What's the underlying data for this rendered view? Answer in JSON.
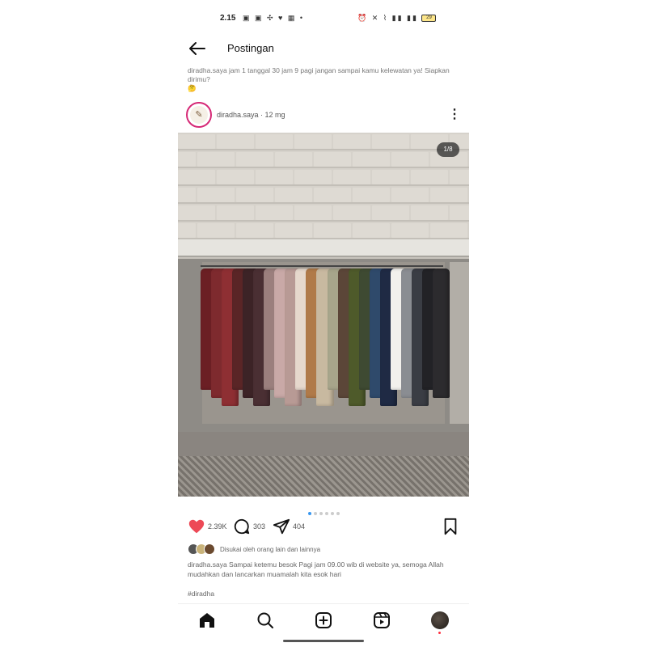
{
  "status_bar": {
    "time": "2.15",
    "left_icons": "▣ ▣ ✣ ♥ ▦ •",
    "right_icons": "⏰ ✕ ⌇ ▮▮ ▮▮",
    "battery": "29"
  },
  "header": {
    "back_icon": "arrow-left-icon",
    "title": "Postingan"
  },
  "caption_top": "diradha.saya jam 1 tanggal 30 jam 9 pagi jangan sampai kamu kelewatan ya! Siapkan dirimu?",
  "caption_top_emoji": "🤔",
  "post": {
    "username": "diradha.saya · 12 mg",
    "avatar_glyph": "✎",
    "image_counter": "1/8",
    "carousel": {
      "count": 6,
      "active": 0
    },
    "likes_count": "2.39K",
    "comments_count": "303",
    "shares_count": "404",
    "liked_by_text": "Disukai oleh orang lain dan lainnya",
    "caption": "diradha.saya Sampai ketemu besok Pagi jam 09.00 wib di website ya, semoga Allah mudahkan dan lancarkan muamalah kita esok hari",
    "hashtags": "#diradha"
  },
  "garment_colors": [
    "#6b1f24",
    "#7e2a2e",
    "#8e2f33",
    "#5a2526",
    "#3c2326",
    "#4a2f33",
    "#9b7f7d",
    "#c9a9a7",
    "#b89a95",
    "#e6d8cc",
    "#b07a49",
    "#c8b9a0",
    "#a7a58b",
    "#5b4638",
    "#4e5a2a",
    "#3e4a32",
    "#2f4a6b",
    "#1f2a44",
    "#f2f0ec",
    "#8a8d92",
    "#3a3d44",
    "#222226",
    "#2c2b2e"
  ],
  "accent": {
    "like": "#ed4956",
    "carousel_active": "#3797f0"
  },
  "nav": {
    "home_icon": "home-icon",
    "search_icon": "search-icon",
    "create_icon": "plus-square-icon",
    "reels_icon": "reels-icon",
    "profile_icon": "profile-avatar"
  }
}
